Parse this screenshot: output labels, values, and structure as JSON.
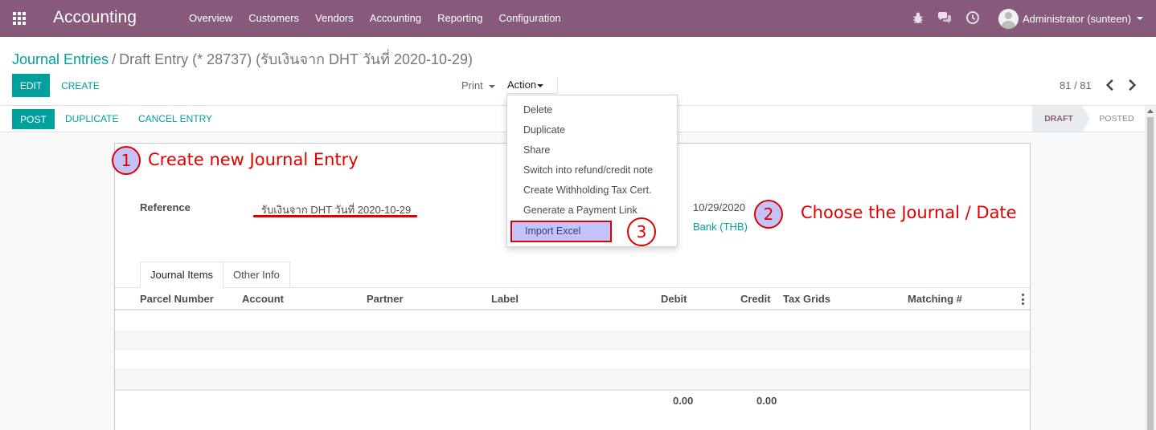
{
  "navbar": {
    "brand": "Accounting",
    "menu": [
      "Overview",
      "Customers",
      "Vendors",
      "Accounting",
      "Reporting",
      "Configuration"
    ],
    "user": "Administrator (sunteen)",
    "icons": [
      "apps-icon",
      "bug-icon",
      "chat-icon",
      "clock-icon"
    ]
  },
  "breadcrumb": {
    "parent": "Journal Entries",
    "separator": "/",
    "current": "Draft Entry (* 28737) (รับเงินจาก DHT วันที่ 2020-10-29)"
  },
  "buttons": {
    "edit": "EDIT",
    "create": "CREATE",
    "print": "Print",
    "action": "Action",
    "post": "POST",
    "duplicate": "DUPLICATE",
    "cancel_entry": "CANCEL ENTRY"
  },
  "pager": {
    "text": "81 / 81"
  },
  "status": {
    "draft": "DRAFT",
    "posted": "POSTED",
    "current": "DRAFT"
  },
  "form": {
    "reference_label": "Reference",
    "reference_value": "รับเงินจาก DHT วันที่ 2020-10-29",
    "date_value": "10/29/2020",
    "journal_value": "Bank (THB)"
  },
  "tabs": [
    "Journal Items",
    "Other Info"
  ],
  "table": {
    "columns": [
      "Parcel Number",
      "Account",
      "Partner",
      "Label",
      "Debit",
      "Credit",
      "Tax Grids",
      "Matching #"
    ],
    "total_debit": "0.00",
    "total_credit": "0.00"
  },
  "action_menu": {
    "items": [
      "Delete",
      "Duplicate",
      "Share",
      "Switch into refund/credit note",
      "Create Withholding Tax Cert.",
      "Generate a Payment Link",
      "Import Excel"
    ],
    "highlighted": "Import Excel"
  },
  "annotations": {
    "step1": {
      "number": "1",
      "text": "Create new Journal Entry"
    },
    "step2": {
      "number": "2",
      "text": "Choose the Journal / Date"
    },
    "step3": {
      "number": "3"
    },
    "color": "#e00000"
  },
  "colors": {
    "navbar": "#875a7b",
    "primary": "#00a09d",
    "highlight": "#c3c3f8"
  }
}
